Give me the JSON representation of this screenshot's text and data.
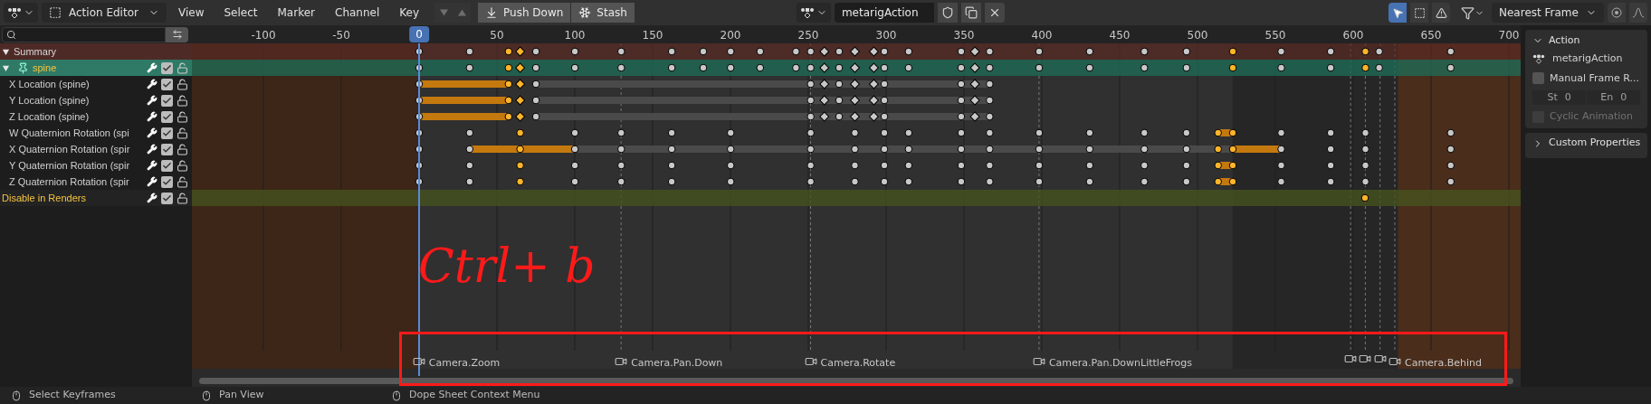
{
  "header": {
    "editor_menu": "Action Editor",
    "menus": [
      "View",
      "Select",
      "Marker",
      "Channel",
      "Key"
    ],
    "layer_buttons": [
      {
        "kind": "down",
        "disabled": true
      },
      {
        "kind": "up",
        "disabled": true
      }
    ],
    "buttons": [
      {
        "kind": "push",
        "label": "Push Down"
      },
      {
        "kind": "stash",
        "label": "Stash"
      }
    ],
    "action_name": "metarigAction",
    "snap_mode": "Nearest Frame"
  },
  "ruler": {
    "ticks": [
      "-100",
      "-50",
      "50",
      "100",
      "150",
      "200",
      "250",
      "300",
      "350",
      "400",
      "450",
      "500",
      "550",
      "600",
      "650",
      "700"
    ],
    "current_frame": "0"
  },
  "channels": [
    {
      "kind": "summary",
      "name": "Summary",
      "expanded": true
    },
    {
      "kind": "group",
      "name": "spine",
      "expanded": true,
      "checked": true
    },
    {
      "kind": "fcurve",
      "name": "X Location (spine)",
      "checked": true
    },
    {
      "kind": "fcurve",
      "name": "Y Location (spine)",
      "checked": true
    },
    {
      "kind": "fcurve",
      "name": "Z Location (spine)",
      "checked": true
    },
    {
      "kind": "fcurve",
      "name": "W Quaternion Rotation (spi",
      "checked": true
    },
    {
      "kind": "fcurve",
      "name": "X Quaternion Rotation (spir",
      "checked": true
    },
    {
      "kind": "fcurve",
      "name": "Y Quaternion Rotation (spir",
      "checked": true
    },
    {
      "kind": "fcurve",
      "name": "Z Quaternion Rotation (spir",
      "checked": true
    },
    {
      "kind": "property",
      "name": "Disable in Renders",
      "checked": true
    }
  ],
  "markers": [
    {
      "kind": "named",
      "name": "Camera.Zoom"
    },
    {
      "kind": "named",
      "name": "Camera.Pan.Down"
    },
    {
      "kind": "named",
      "name": "Camera.Rotate"
    },
    {
      "kind": "named",
      "name": "Camera.Pan.DownLittleFrogs"
    },
    {
      "kind": "unnamed"
    },
    {
      "kind": "unnamed"
    },
    {
      "kind": "unnamed"
    },
    {
      "kind": "named",
      "name": "Camera.Behind"
    }
  ],
  "sidebar": {
    "panels": [
      {
        "kind": "action",
        "title": "Action",
        "expanded": true,
        "action_name": "metarigAction",
        "manual_frame_range": {
          "label": "Manual Frame R...",
          "checked": false
        },
        "start": {
          "label": "St",
          "value": "0"
        },
        "end": {
          "label": "En",
          "value": "0"
        },
        "cyclic": {
          "label": "Cyclic Animation",
          "checked": false,
          "disabled": true
        }
      },
      {
        "kind": "custom",
        "title": "Custom Properties",
        "expanded": false
      }
    ]
  },
  "status_bar": [
    {
      "label": "Select Keyframes"
    },
    {
      "label": "Pan View"
    },
    {
      "label": "Dope Sheet Context Menu"
    }
  ],
  "annotation": {
    "text": "Ctrl+ b"
  }
}
